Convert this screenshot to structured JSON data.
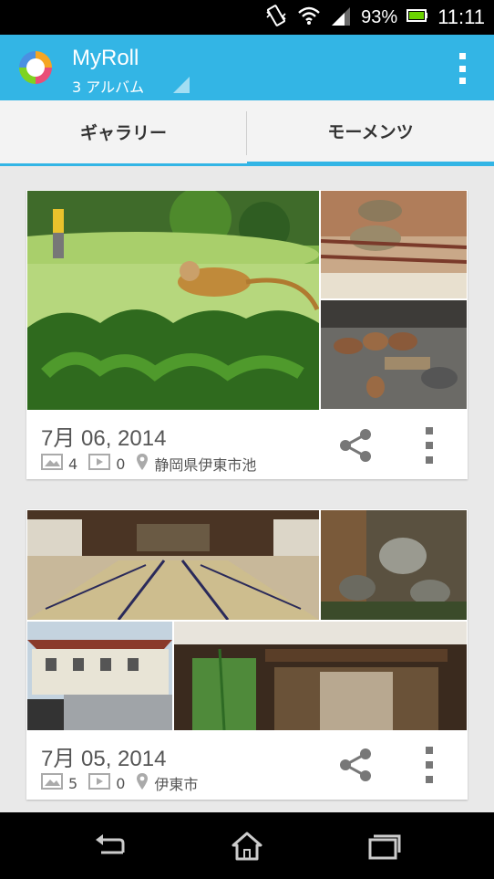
{
  "status": {
    "battery": "93%",
    "time": "11:11"
  },
  "app": {
    "title": "MyRoll",
    "subtitle": "3 アルバム"
  },
  "tabs": [
    {
      "label": "ギャラリー",
      "selected": false
    },
    {
      "label": "モーメンツ",
      "selected": true
    }
  ],
  "moments": [
    {
      "date": "7月 06, 2014",
      "photo_count": "4",
      "video_count": "0",
      "location": "静岡県伊東市池"
    },
    {
      "date": "7月 05, 2014",
      "photo_count": "5",
      "video_count": "0",
      "location": "伊東市"
    }
  ],
  "colors": {
    "accent": "#33b5e5"
  }
}
